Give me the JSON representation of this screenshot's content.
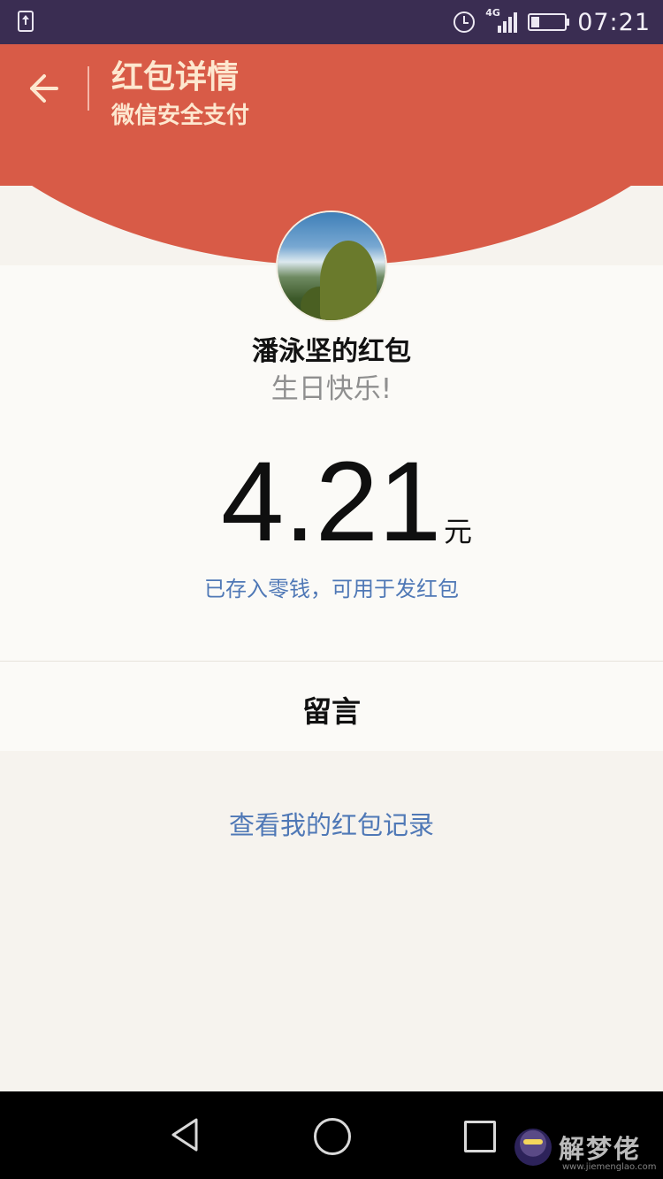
{
  "status_bar": {
    "network": "4G",
    "battery_level_percent": 25,
    "time": "07:21"
  },
  "header": {
    "title": "红包详情",
    "subtitle": "微信安全支付"
  },
  "sender": {
    "name": "潘泳坚的红包",
    "greeting": "生日快乐!"
  },
  "amount": {
    "value": "4.21",
    "currency": "元",
    "note": "已存入零钱，可用于发红包"
  },
  "message_label": "留言",
  "history_link": "查看我的红包记录",
  "watermark": {
    "text": "解梦佬",
    "url": "www.jiemenglao.com"
  },
  "colors": {
    "header_red": "#d85b47",
    "header_text": "#fde7cf",
    "link_blue": "#4f78b6",
    "status_bar": "#3a2d52"
  },
  "icons": {
    "status_left": "upload-icon",
    "alarm": "alarm-icon",
    "signal": "signal-icon",
    "battery": "battery-icon",
    "back": "back-arrow-icon",
    "nav_back": "nav-back-icon",
    "nav_home": "nav-home-icon",
    "nav_recent": "nav-recent-icon"
  }
}
